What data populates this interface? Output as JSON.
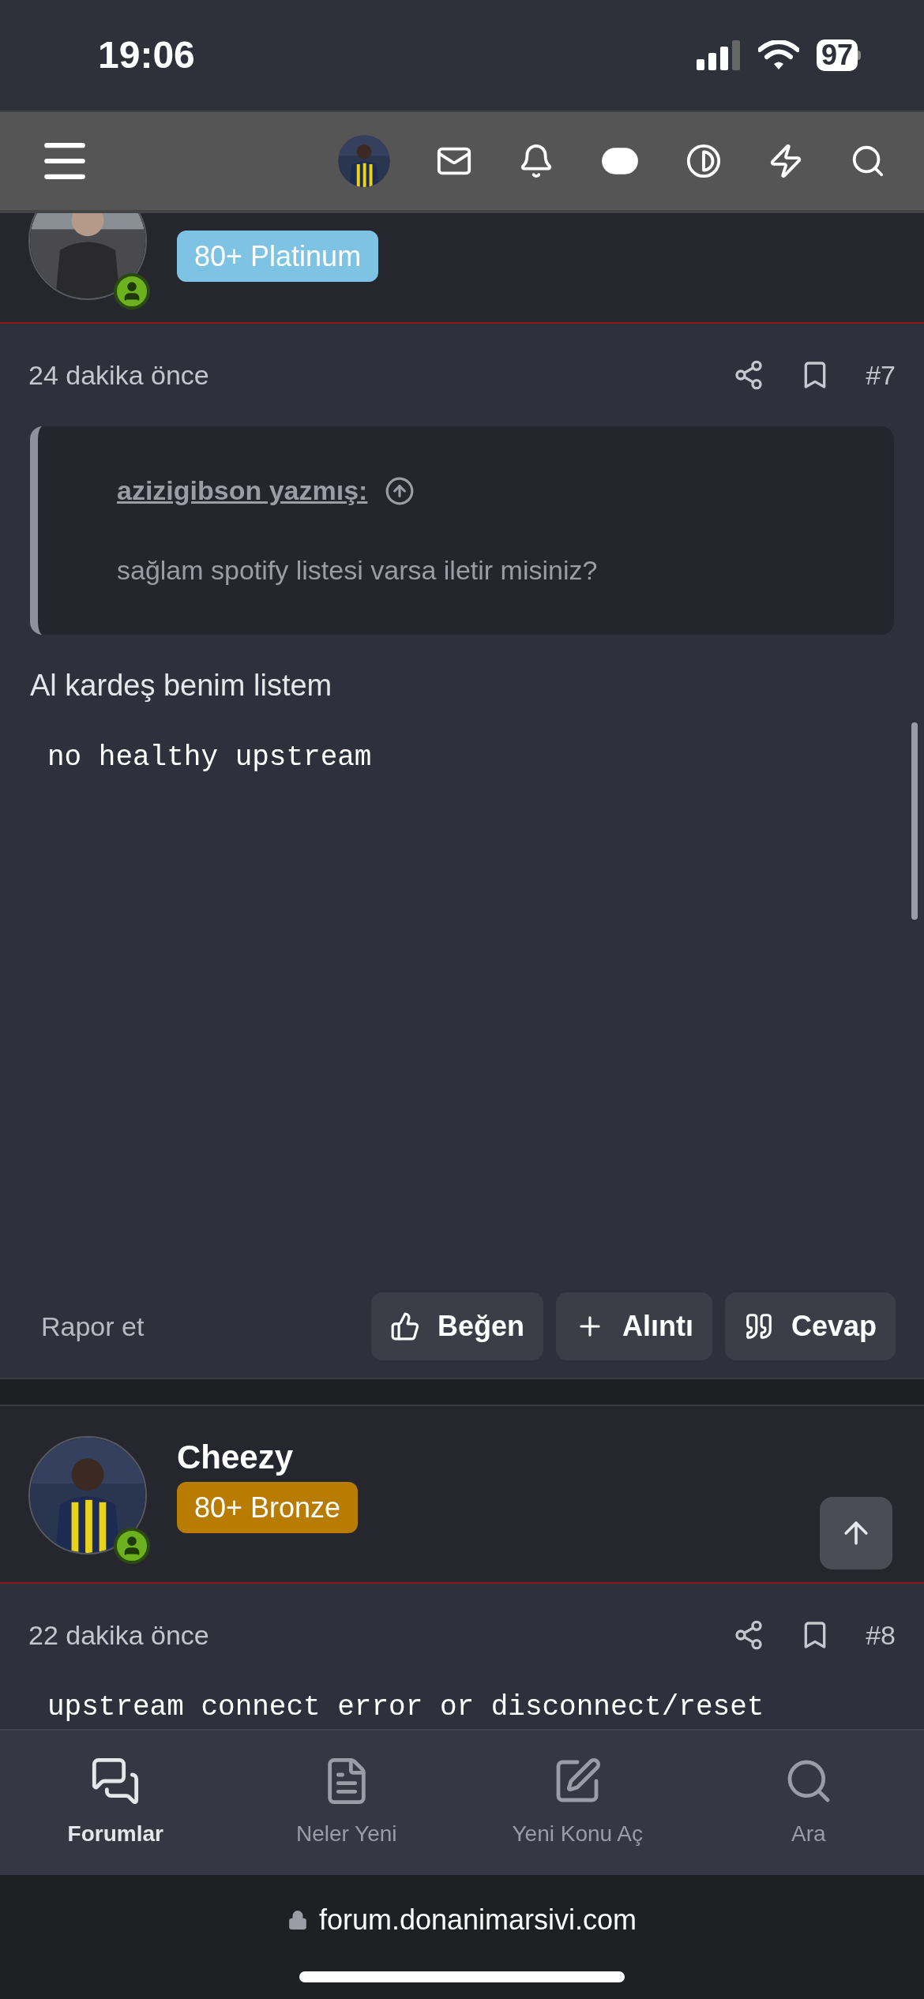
{
  "status_bar": {
    "time": "19:06",
    "battery": "97"
  },
  "posts": [
    {
      "user": {
        "rank": "80+ Platinum",
        "color": "#7ec3e3",
        "online": true
      },
      "time": "24 dakika önce",
      "number": "#7",
      "quote": {
        "author": "azizigibson yazmış:",
        "text": "sağlam spotify listesi varsa iletir misiniz?"
      },
      "body": "Al kardeş benim listem",
      "code": "no healthy upstream",
      "report": "Rapor et",
      "actions": [
        {
          "kind": "like",
          "label": "Beğen"
        },
        {
          "kind": "quote",
          "label": "Alıntı"
        },
        {
          "kind": "reply",
          "label": "Cevap"
        }
      ]
    },
    {
      "user": {
        "name": "Cheezy",
        "rank": "80+ Bronze",
        "color": "#b77c00",
        "online": true
      },
      "time": "22 dakika önce",
      "number": "#8",
      "code": "upstream connect error or disconnect/reset"
    }
  ],
  "bottom_nav": [
    {
      "label": "Forumlar",
      "selected": true
    },
    {
      "label": "Neler Yeni",
      "selected": false
    },
    {
      "label": "Yeni Konu Aç",
      "selected": false
    },
    {
      "label": "Ara",
      "selected": false
    }
  ],
  "url": "forum.donanimarsivi.com"
}
